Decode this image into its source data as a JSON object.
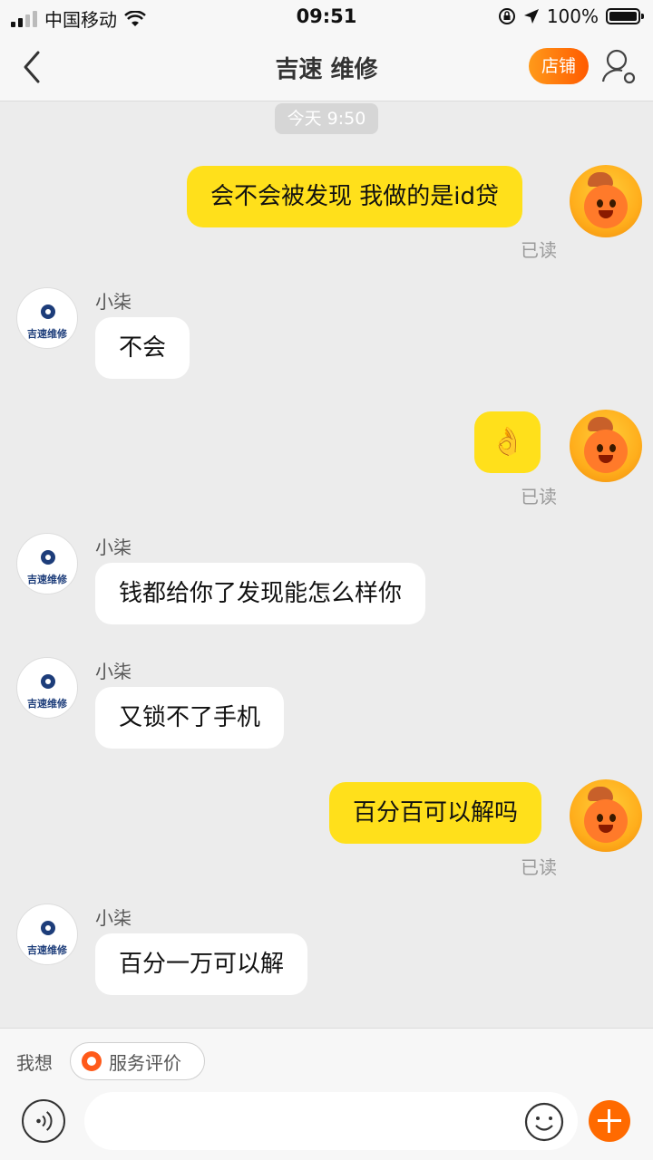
{
  "status_bar": {
    "carrier": "中国移动",
    "time": "09:51",
    "battery": "100%"
  },
  "nav": {
    "title": "吉速 维修",
    "shop_label": "店铺"
  },
  "timestamp": "今天 9:50",
  "shop_avatar_text": "吉速维修",
  "messages": [
    {
      "dir": "out",
      "text": "会不会被发现  我做的是id贷",
      "status": "已读"
    },
    {
      "dir": "in",
      "sender": "小柒",
      "text": "不会"
    },
    {
      "dir": "out",
      "text": "👌",
      "status": "已读"
    },
    {
      "dir": "in",
      "sender": "小柒",
      "text": "钱都给你了发现能怎么样你"
    },
    {
      "dir": "in",
      "sender": "小柒",
      "text": "又锁不了手机"
    },
    {
      "dir": "out",
      "text": "百分百可以解吗",
      "status": "已读"
    },
    {
      "dir": "in",
      "sender": "小柒",
      "text": "百分一万可以解"
    }
  ],
  "bottom": {
    "want_label": "我想",
    "service_label": "服务评价",
    "input_value": "",
    "input_placeholder": ""
  },
  "colors": {
    "out_bubble": "#ffe01b",
    "accent": "#ff6a00"
  }
}
